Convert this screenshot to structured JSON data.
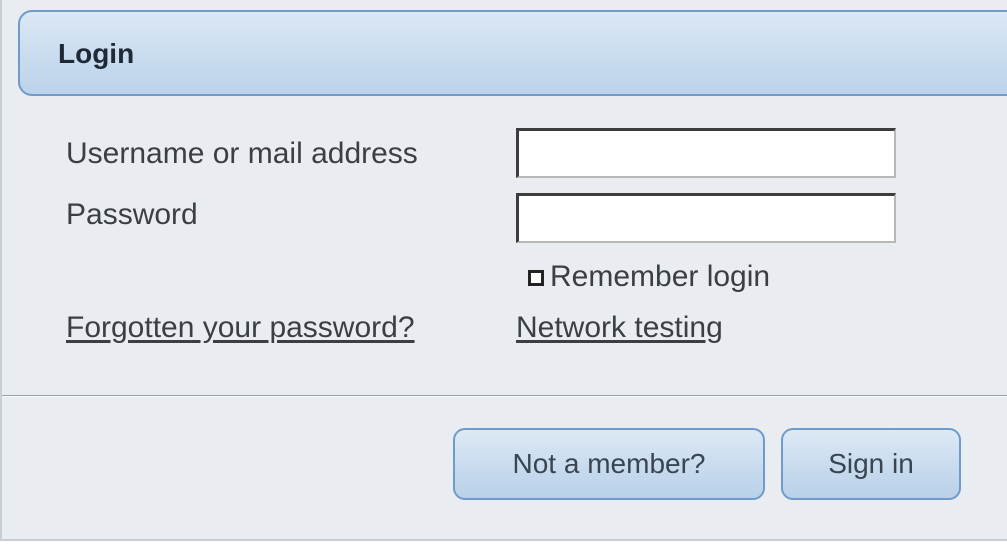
{
  "header": {
    "title": "Login"
  },
  "form": {
    "username_label": "Username or mail address",
    "username_value": "",
    "password_label": "Password",
    "password_value": "",
    "remember_label": "Remember login",
    "remember_checked": false
  },
  "links": {
    "forgot_password": "Forgotten your password?",
    "network_testing": "Network testing"
  },
  "buttons": {
    "not_member": "Not a member?",
    "sign_in": "Sign in"
  },
  "colors": {
    "panel_background": "#e9edf2",
    "header_border": "#6f9bc8",
    "button_gradient_top": "#dde9f5",
    "button_gradient_bottom": "#b9d1e9",
    "text": "#3b3f44"
  }
}
